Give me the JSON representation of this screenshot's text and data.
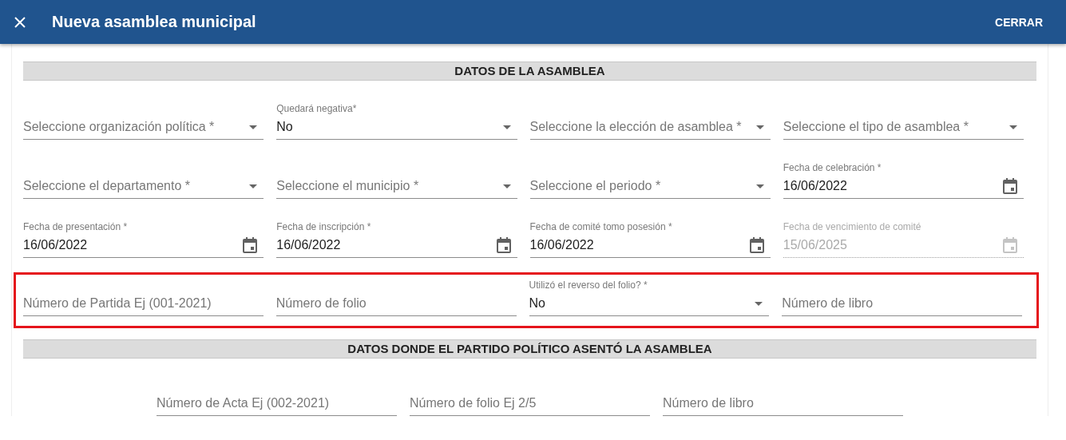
{
  "dialog": {
    "title": "Nueva asamblea municipal",
    "close_button": "CERRAR"
  },
  "sections": [
    {
      "title": "DATOS DE LA ASAMBLEA",
      "rows": [
        {
          "highlighted": false,
          "fields": [
            {
              "kind": "select",
              "placeholder": "Seleccione organización política *",
              "disabled": false
            },
            {
              "kind": "select",
              "label": "Quedará negativa*",
              "value": "No",
              "disabled": false
            },
            {
              "kind": "select",
              "placeholder": "Seleccione la elección de asamblea *",
              "disabled": false
            },
            {
              "kind": "select",
              "placeholder": "Seleccione el tipo de asamblea *",
              "disabled": false
            }
          ]
        },
        {
          "highlighted": false,
          "fields": [
            {
              "kind": "select",
              "placeholder": "Seleccione el departamento *",
              "disabled": false
            },
            {
              "kind": "select",
              "placeholder": "Seleccione el municipio *",
              "disabled": false
            },
            {
              "kind": "select",
              "placeholder": "Seleccione el periodo *",
              "disabled": false
            },
            {
              "kind": "date",
              "label": "Fecha de celebración *",
              "value": "16/06/2022",
              "disabled": false
            }
          ]
        },
        {
          "highlighted": false,
          "fields": [
            {
              "kind": "date",
              "label": "Fecha de presentación *",
              "value": "16/06/2022",
              "disabled": false
            },
            {
              "kind": "date",
              "label": "Fecha de inscripción *",
              "value": "16/06/2022",
              "disabled": false
            },
            {
              "kind": "date",
              "label": "Fecha de comité tomo posesión *",
              "value": "16/06/2022",
              "disabled": false
            },
            {
              "kind": "date",
              "label": "Fecha de vencimiento de comité",
              "value": "15/06/2025",
              "disabled": true
            }
          ]
        },
        {
          "highlighted": true,
          "fields": [
            {
              "kind": "text",
              "placeholder": "Número de Partida Ej (001-2021)",
              "disabled": false
            },
            {
              "kind": "text",
              "placeholder": "Número de folio",
              "disabled": false
            },
            {
              "kind": "select",
              "label": "Utilizó el reverso del folio? *",
              "value": "No",
              "disabled": false
            },
            {
              "kind": "text",
              "placeholder": "Número de libro",
              "disabled": false
            }
          ]
        }
      ]
    },
    {
      "title": "DATOS DONDE EL PARTIDO POLÍTICO ASENTÓ LA ASAMBLEA",
      "rows": [
        {
          "highlighted": false,
          "fields": [
            {
              "kind": "text",
              "placeholder": "Número de Acta Ej (002-2021)",
              "disabled": false
            },
            {
              "kind": "text",
              "placeholder": "Número de folio Ej 2/5",
              "disabled": false
            },
            {
              "kind": "text",
              "placeholder": "Número de libro",
              "disabled": false
            }
          ]
        }
      ]
    }
  ]
}
